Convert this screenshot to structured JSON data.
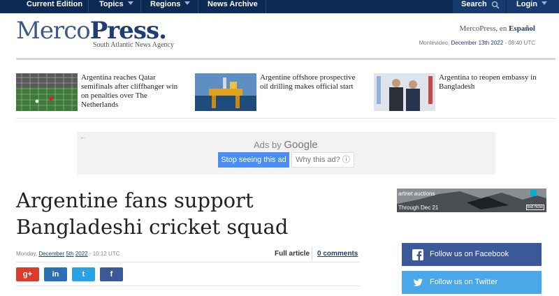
{
  "nav": {
    "current_edition": "Current Edition",
    "topics": "Topics",
    "regions": "Regions",
    "news_archive": "News Archive",
    "search": "Search",
    "login": "Login"
  },
  "masthead": {
    "logo_light": "Merco",
    "logo_bold": "Press.",
    "tagline": "South Atlantic News Agency",
    "lang_prefix": "MercoPress, en",
    "lang_link": "Español",
    "date_city": "Montevideo,",
    "date_day": "December 13th 2022",
    "date_time": "- 08:40 UTC"
  },
  "teasers": [
    {
      "title": "Argentina reaches Qatar semifinals after cliffhanger win on penalties over The Netherlands",
      "image": "football-match-photo"
    },
    {
      "title": "Argentine offshore prospective oil drilling makes official start",
      "image": "oil-platform-photo"
    },
    {
      "title": "Argentina to reopen embassy in Bangladesh",
      "image": "diplomats-handshake-photo"
    }
  ],
  "ad": {
    "back": "←",
    "ads_by": "Ads by",
    "google": "Google",
    "stop_label": "Stop seeing this ad",
    "why_label": "Why this ad?",
    "why_icon": "ⓘ"
  },
  "article": {
    "headline": "Argentine fans support Bangladeshi cricket squad",
    "weekday": "Monday,",
    "month": "December",
    "day": "5th",
    "year": "2022",
    "time": "- 10:12 UTC",
    "full_article": "Full article",
    "comments": "0 comments"
  },
  "share": [
    {
      "label": "g+",
      "color": "#dc3b2b",
      "icon": "google-plus-icon"
    },
    {
      "label": "in",
      "color": "#2b6fb7",
      "icon": "linkedin-icon"
    },
    {
      "label": "t",
      "color": "#2aa3e6",
      "icon": "twitter-icon"
    },
    {
      "label": "f",
      "color": "#3b5998",
      "icon": "facebook-icon"
    }
  ],
  "side_ad": {
    "line1": "artnet  auctions",
    "line2": "Through Dec 21",
    "cta": "Bid Now"
  },
  "social": {
    "facebook_label": "Follow us on Facebook",
    "twitter_label": "Follow us on Twitter",
    "facebook_color": "#3b5998",
    "twitter_color": "#4aa8e8"
  }
}
